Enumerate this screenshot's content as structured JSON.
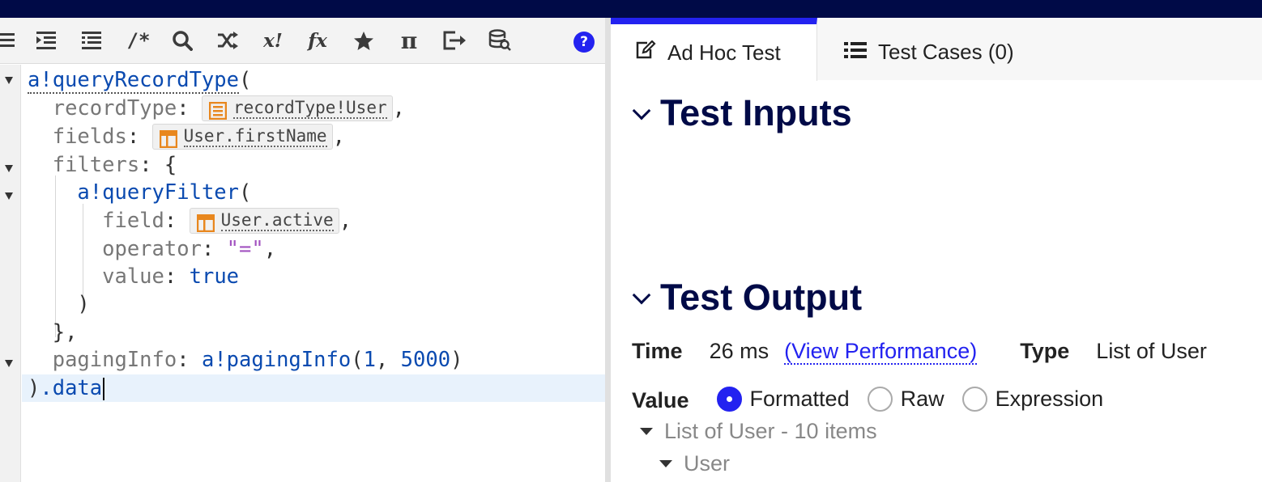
{
  "editor": {
    "toolbar_icons": [
      "list-icon",
      "indent-icon",
      "outdent-icon",
      "comment-icon",
      "search-icon",
      "shuffle-icon",
      "variable-icon",
      "function-icon",
      "star-icon",
      "pi-icon",
      "export-icon",
      "database-icon"
    ],
    "toolbar_glyphs": {
      "comment": "/*",
      "variable": "x!",
      "function": "fx",
      "pi": "π"
    },
    "help_label": "?",
    "lines": {
      "l1_fn": "a!queryRecordType",
      "l1_paren": "(",
      "l2_key": "recordType",
      "l2_chip": "recordType!User",
      "l3_key": "fields",
      "l3_chip": "User.firstName",
      "l4_key": "filters",
      "l4_brace": "{",
      "l5_fn": "a!queryFilter",
      "l5_paren": "(",
      "l6_key": "field",
      "l6_chip": "User.active",
      "l7_key": "operator",
      "l7_val": "\"=\"",
      "l8_key": "value",
      "l8_val": "true",
      "l9": ")",
      "l10": "},",
      "l11_key": "pagingInfo",
      "l11_fn": "a!pagingInfo",
      "l11_arg1": "1",
      "l11_arg2": "5000",
      "l12_paren": ")",
      "l12_rest": ".data",
      "colon": ":",
      "comma": ",",
      "open": "(",
      "close": ")",
      "arg_sep": ", "
    }
  },
  "right": {
    "tabs": [
      {
        "label": "Ad Hoc Test",
        "icon": "edit-icon"
      },
      {
        "label": "Test Cases (0)",
        "icon": "list-icon"
      }
    ],
    "inputs_title": "Test Inputs",
    "output_title": "Test Output",
    "time_label": "Time",
    "time_value": "26 ms",
    "perf_link": "(View Performance)",
    "type_label": "Type",
    "type_value": "List of User",
    "value_label": "Value",
    "value_options": [
      "Formatted",
      "Raw",
      "Expression"
    ],
    "selected_option": "Formatted",
    "tree": [
      {
        "label": "List of User - 10 items"
      },
      {
        "label": "User"
      }
    ]
  },
  "colors": {
    "accent": "#2322f0",
    "header_navy": "#000a47",
    "chip_icon": "#e8871e"
  }
}
